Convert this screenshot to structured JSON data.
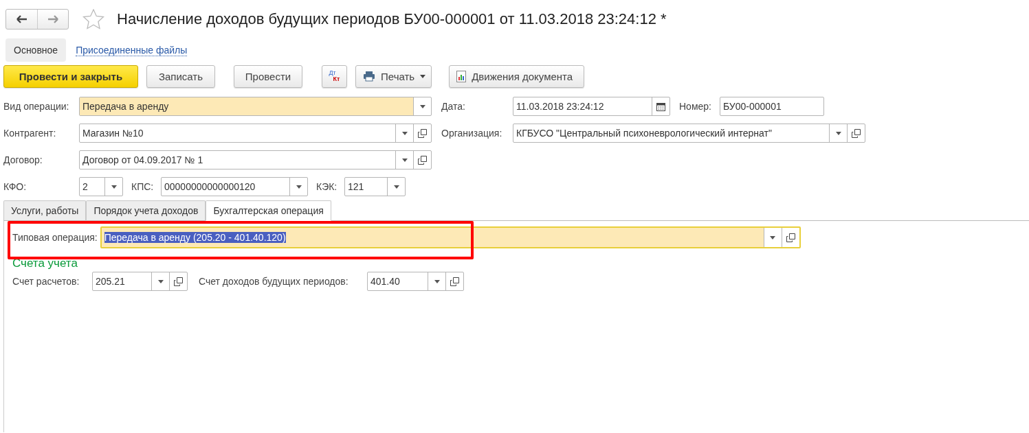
{
  "title": "Начисление доходов будущих периодов БУ00-000001 от 11.03.2018 23:24:12 *",
  "favorite": false,
  "sections": [
    {
      "label": "Основное",
      "selected": true
    },
    {
      "label": "Присоединенные файлы",
      "selected": false
    }
  ],
  "toolbar": [
    {
      "kind": "primary",
      "label": "Провести и закрыть"
    },
    {
      "kind": "plain",
      "label": "Записать"
    },
    {
      "kind": "plain",
      "label": "Провести"
    },
    {
      "kind": "dtkt",
      "label": "Дт",
      "label2": "Кт"
    },
    {
      "kind": "print",
      "label": "Печать"
    },
    {
      "kind": "report",
      "label": "Движения документа"
    }
  ],
  "header_rows": [
    [
      {
        "kind": "select",
        "label": "Вид операции:",
        "value": "Передача в аренду",
        "highlighted": true
      },
      {
        "kind": "date",
        "label": "Дата:",
        "value": "11.03.2018 23:24:12",
        "highlighted": false
      },
      {
        "kind": "text",
        "label": "Номер:",
        "value": "БУ00-000001",
        "highlighted": false
      }
    ],
    [
      {
        "kind": "reference",
        "label": "Контрагент:",
        "value": "Магазин №10",
        "highlighted": false
      },
      {
        "kind": "reference",
        "label": "Организация:",
        "value": "КГБУСО \"Центральный психоневрологический интернат\"",
        "highlighted": false
      }
    ],
    [
      {
        "kind": "reference",
        "label": "Договор:",
        "value": "Договор от 04.09.2017 № 1",
        "highlighted": false
      }
    ],
    [
      {
        "kind": "select",
        "label": "КФО:",
        "value": "2",
        "highlighted": false
      },
      {
        "kind": "select",
        "label": "КПС:",
        "value": "00000000000000120",
        "highlighted": false
      },
      {
        "kind": "select",
        "label": "КЭК:",
        "value": "121",
        "highlighted": false
      }
    ]
  ],
  "tabs": [
    {
      "label": "Услуги, работы",
      "selected": false
    },
    {
      "label": "Порядок учета доходов",
      "selected": false
    },
    {
      "label": "Бухгалтерская операция",
      "selected": true
    }
  ],
  "typical_operation": {
    "label": "Типовая операция:",
    "value": "Передача в аренду (205.20 - 401.40.120)",
    "highlighted": true,
    "focused": true,
    "text_selected": true,
    "annotated": true,
    "kind": "reference"
  },
  "accounts": {
    "heading": "Счета учета",
    "fields": [
      {
        "kind": "reference",
        "label": "Счет расчетов:",
        "value": "205.21",
        "highlighted": false
      },
      {
        "kind": "reference",
        "label": "Счет доходов будущих периодов:",
        "value": "401.40",
        "highlighted": false
      }
    ]
  }
}
